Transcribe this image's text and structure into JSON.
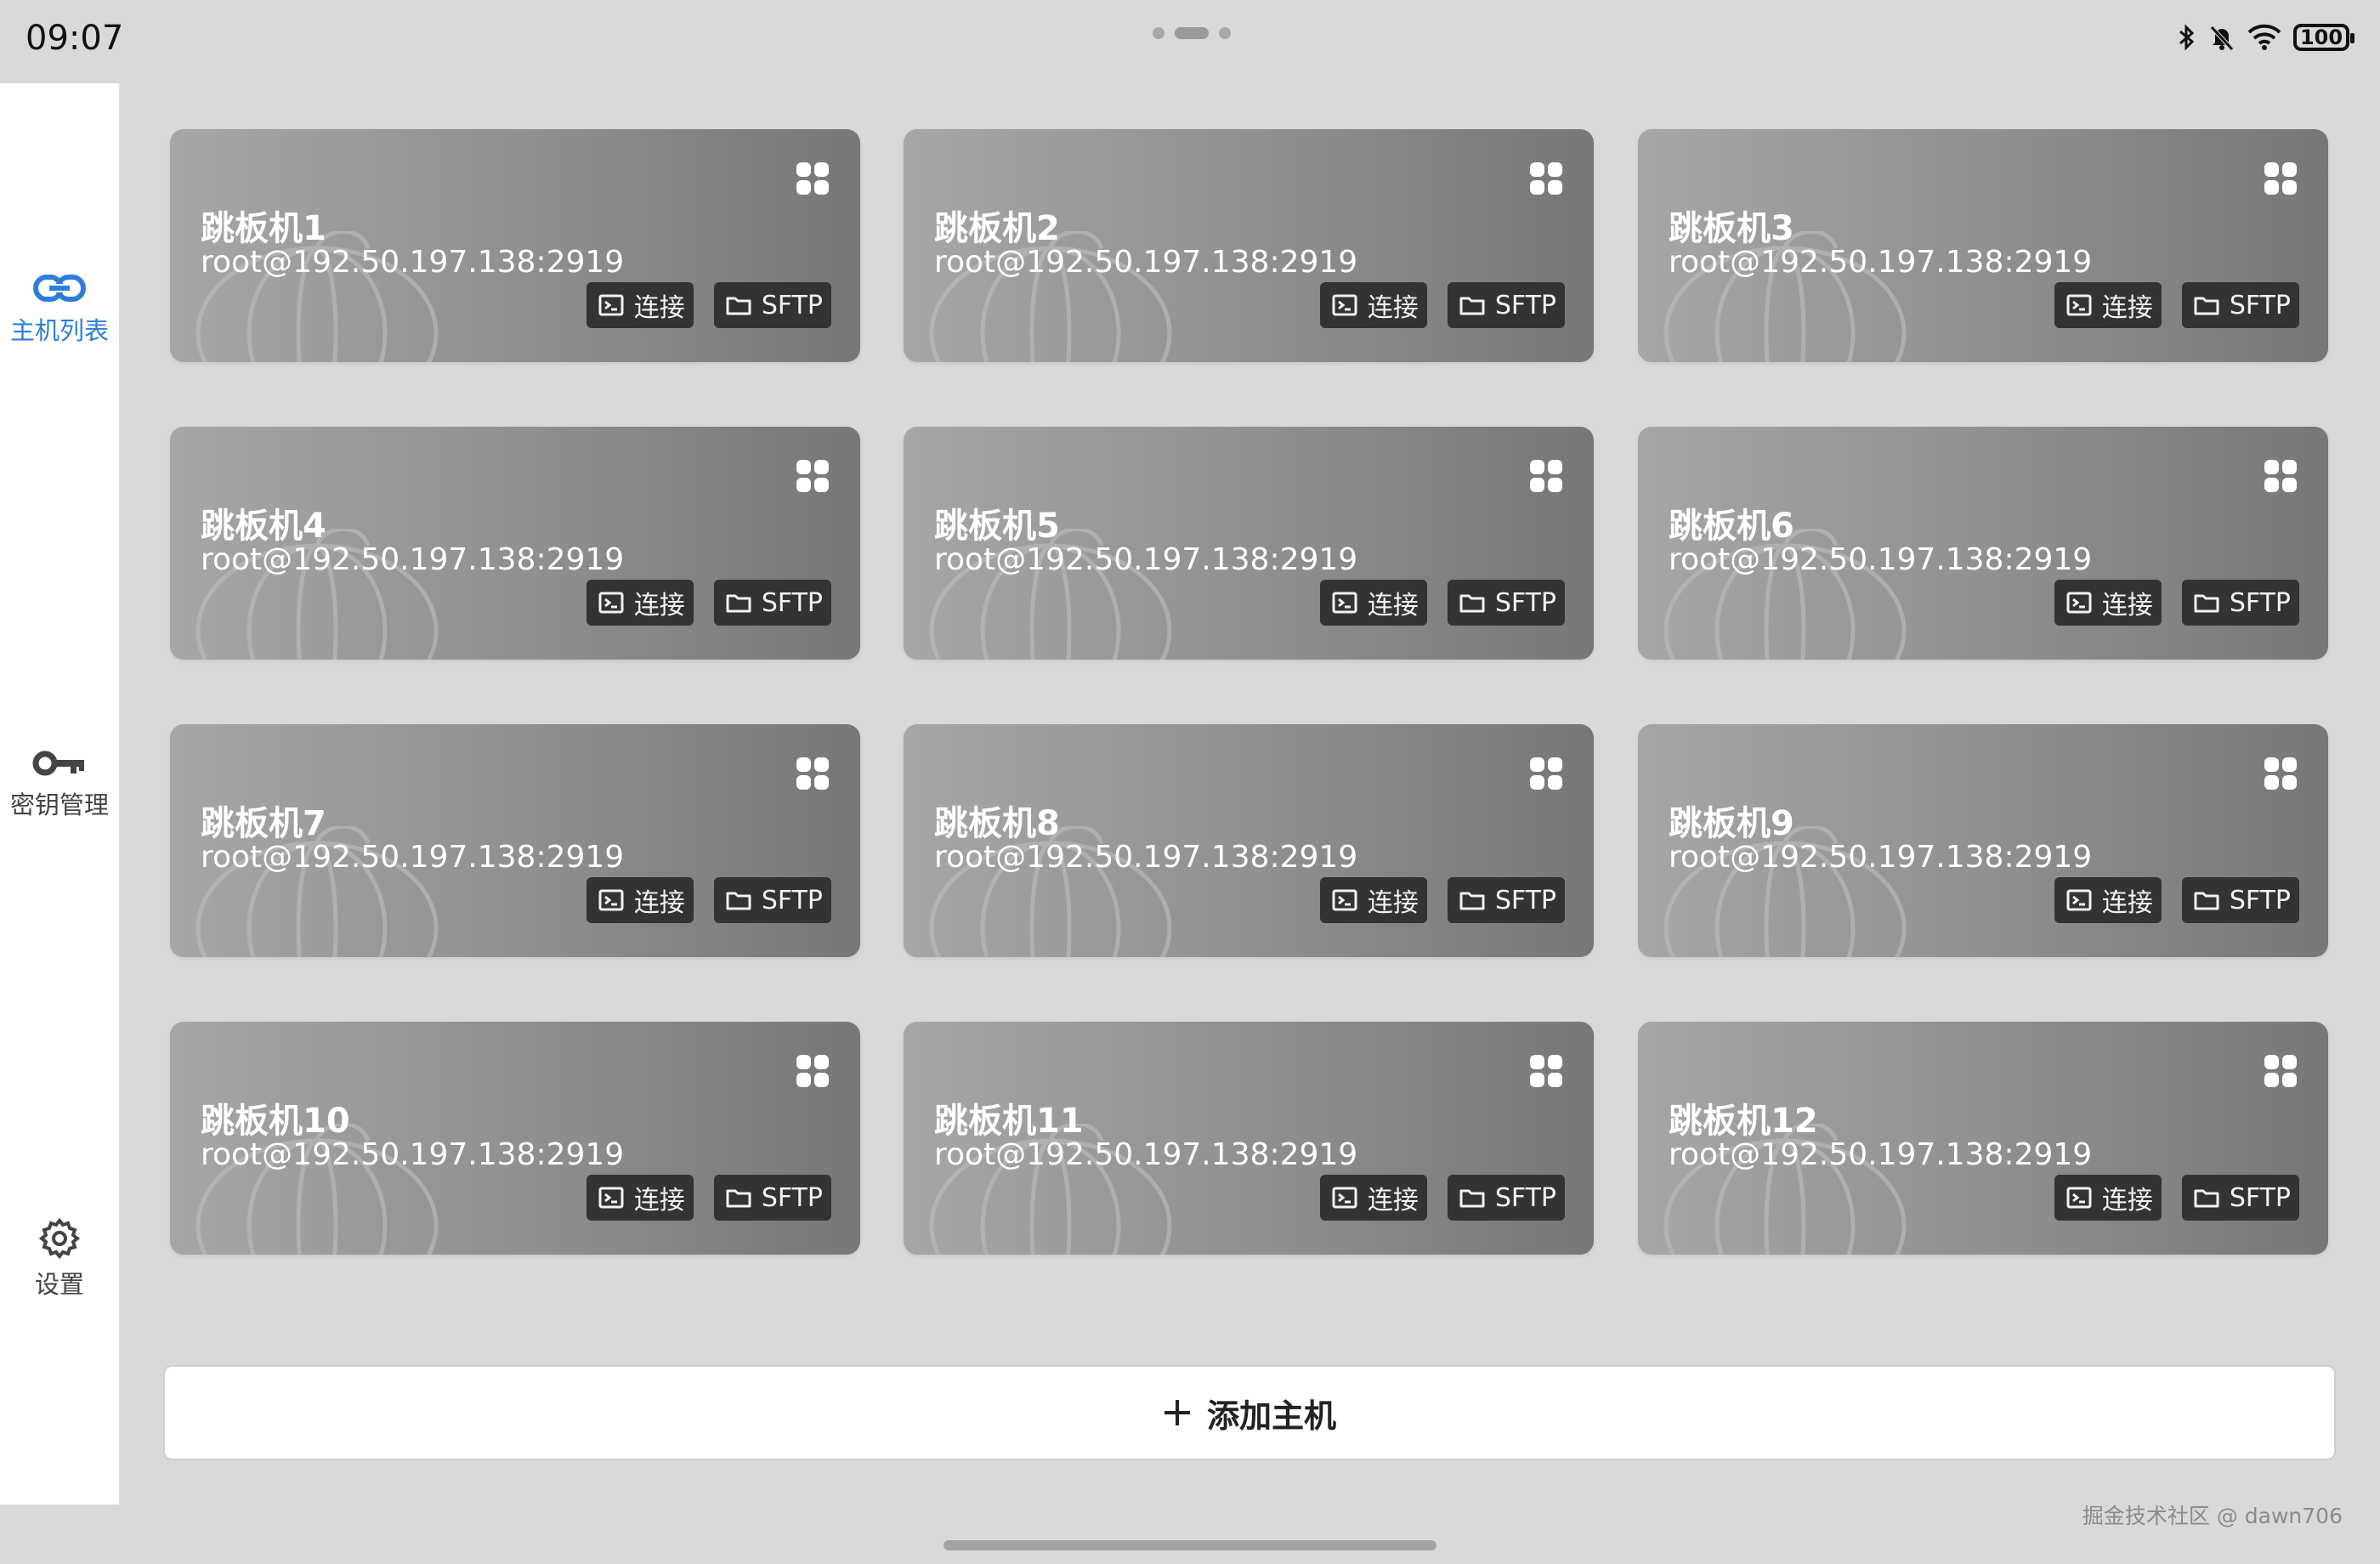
{
  "status_bar": {
    "time": "09:07",
    "battery": "100"
  },
  "sidebar": {
    "items": [
      {
        "label": "主机列表",
        "icon": "link-icon",
        "active": true
      },
      {
        "label": "密钥管理",
        "icon": "key-icon",
        "active": false
      },
      {
        "label": "设置",
        "icon": "gear-icon",
        "active": false
      }
    ]
  },
  "hosts": [
    {
      "name": "跳板机1",
      "address": "root@192.50.197.138:2919"
    },
    {
      "name": "跳板机2",
      "address": "root@192.50.197.138:2919"
    },
    {
      "name": "跳板机3",
      "address": "root@192.50.197.138:2919"
    },
    {
      "name": "跳板机4",
      "address": "root@192.50.197.138:2919"
    },
    {
      "name": "跳板机5",
      "address": "root@192.50.197.138:2919"
    },
    {
      "name": "跳板机6",
      "address": "root@192.50.197.138:2919"
    },
    {
      "name": "跳板机7",
      "address": "root@192.50.197.138:2919"
    },
    {
      "name": "跳板机8",
      "address": "root@192.50.197.138:2919"
    },
    {
      "name": "跳板机9",
      "address": "root@192.50.197.138:2919"
    },
    {
      "name": "跳板机10",
      "address": "root@192.50.197.138:2919"
    },
    {
      "name": "跳板机11",
      "address": "root@192.50.197.138:2919"
    },
    {
      "name": "跳板机12",
      "address": "root@192.50.197.138:2919"
    }
  ],
  "host_actions": {
    "connect_label": "连接",
    "sftp_label": "SFTP"
  },
  "add_host": {
    "label": "添加主机"
  },
  "watermark": "掘金技术社区 @ dawn706",
  "colors": {
    "accent": "#2e7ed8",
    "card_button": "#333333"
  }
}
